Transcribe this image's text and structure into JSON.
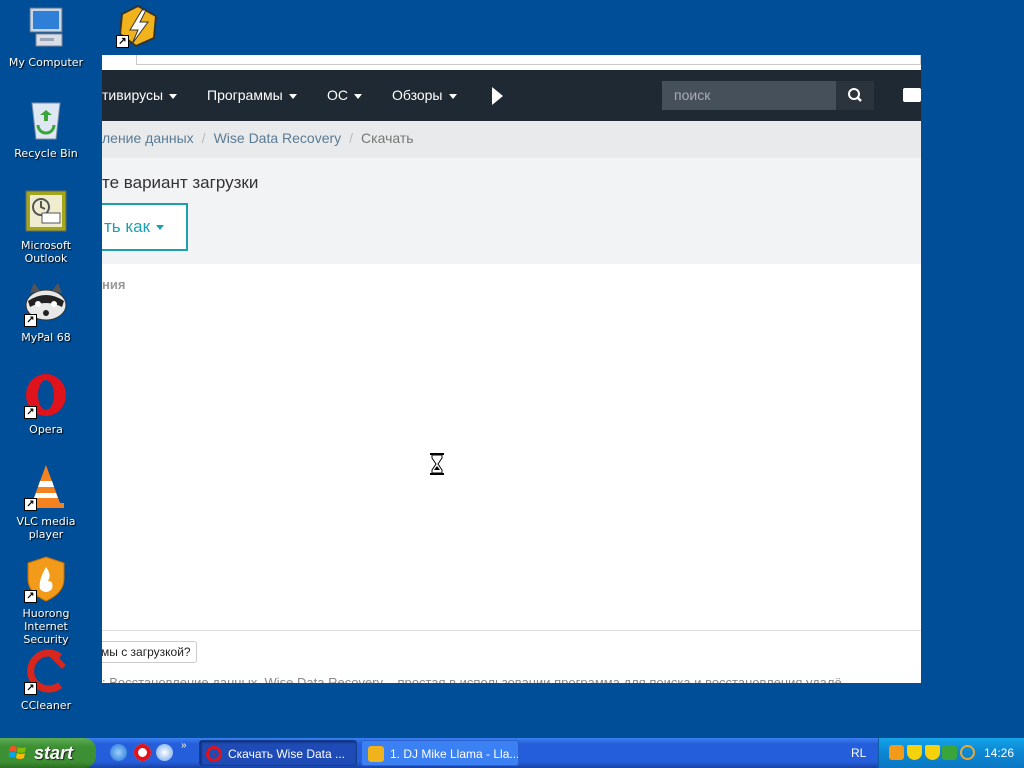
{
  "desktop": {
    "icons": [
      {
        "label": "My Computer"
      },
      {
        "label": "Recycle Bin"
      },
      {
        "label": "Microsoft Outlook"
      },
      {
        "label": "MyPal 68"
      },
      {
        "label": "Opera"
      },
      {
        "label": "VLC media player"
      },
      {
        "label": "Huorong Internet Security"
      },
      {
        "label": "CCleaner"
      }
    ]
  },
  "browser": {
    "nav": {
      "items": [
        "тивирусы",
        "Программы",
        "ОС",
        "Обзоры"
      ],
      "search_placeholder": "поиск"
    },
    "breadcrumb": {
      "items": [
        "ление данных",
        "Wise Data Recovery"
      ],
      "current": "Скачать"
    },
    "download_panel": {
      "heading": "те вариант загрузки",
      "button_label": "ть как"
    },
    "section_label": "ния",
    "problem_button": "мы с загрузкой?",
    "description": ": Восстановление данных. Wise Data Recovery – простая в использовании программа для поиска и восстановления удалё"
  },
  "taskbar": {
    "start_label": "start",
    "tasks": [
      {
        "label": "Скачать Wise Data ...",
        "active": true
      },
      {
        "label": "1. DJ Mike Llama - Lla...",
        "active": false
      }
    ],
    "language": "RL",
    "clock": "14:26"
  },
  "colors": {
    "desktop_bg": "#004e98",
    "topnav_bg": "#1f2933",
    "accent": "#1b9fb1",
    "taskbar": "#245edb",
    "start_button": "#3c8f32"
  }
}
